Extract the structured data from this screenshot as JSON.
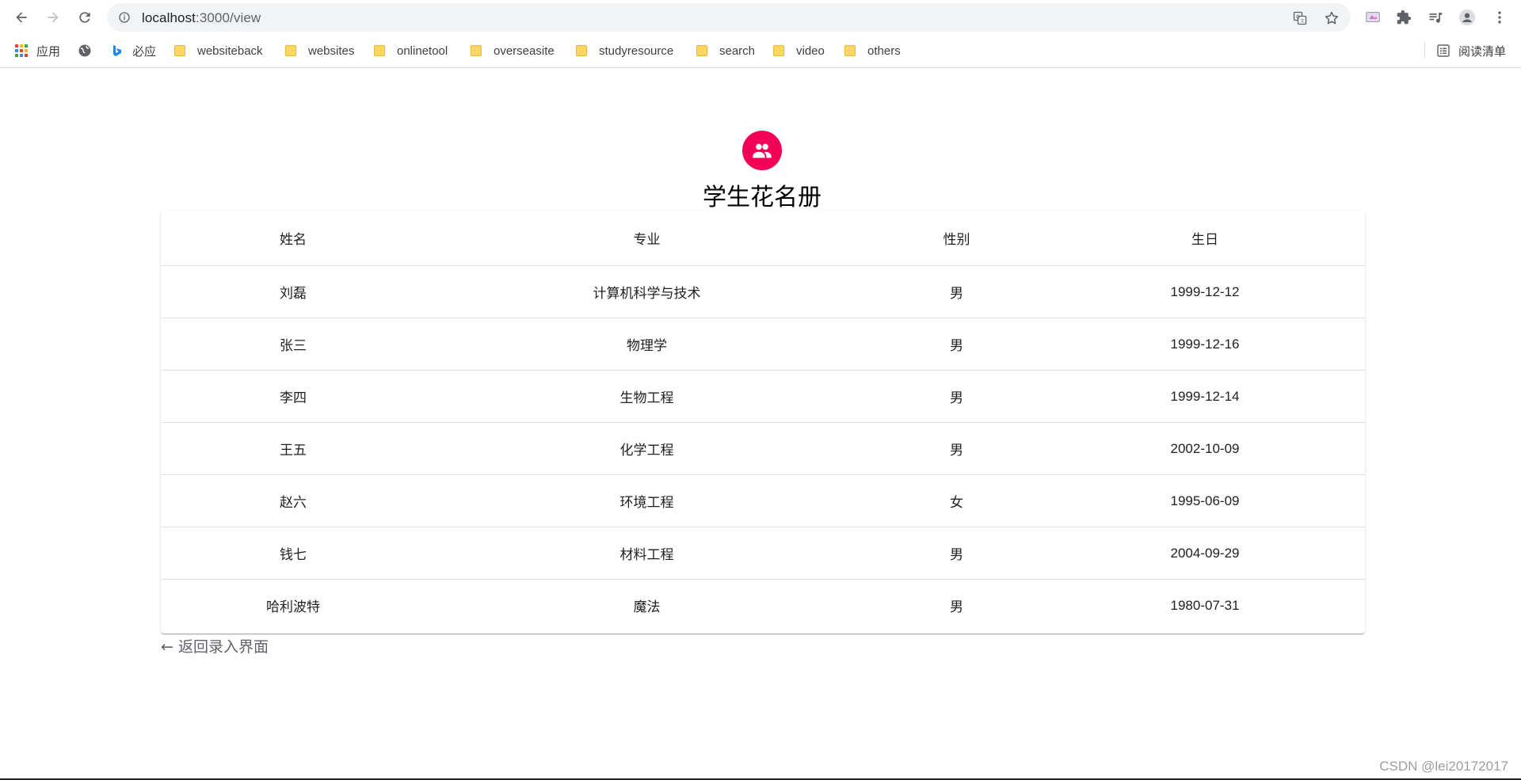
{
  "browser": {
    "url_host": "localhost",
    "url_path": ":3000/view",
    "bookmarks": [
      {
        "label": "应用",
        "icon": "apps-grid-icon"
      },
      {
        "label": "",
        "icon": "globe-icon"
      },
      {
        "label": "必应",
        "icon": "bing-icon"
      },
      {
        "label": "websiteback",
        "icon": "folder-icon"
      },
      {
        "label": "websites",
        "icon": "folder-icon"
      },
      {
        "label": "onlinetool",
        "icon": "folder-icon"
      },
      {
        "label": "overseasite",
        "icon": "folder-icon"
      },
      {
        "label": "studyresource",
        "icon": "folder-icon"
      },
      {
        "label": "search",
        "icon": "folder-icon"
      },
      {
        "label": "video",
        "icon": "folder-icon"
      },
      {
        "label": "others",
        "icon": "folder-icon"
      }
    ],
    "reading_list_label": "阅读清单"
  },
  "page": {
    "title": "学生花名册",
    "avatar_icon": "people-icon",
    "accent_color": "#f50057",
    "back_link": "← 返回录入界面",
    "watermark": "CSDN @lei20172017"
  },
  "table": {
    "headers": [
      "姓名",
      "专业",
      "性别",
      "生日"
    ],
    "rows": [
      {
        "name": "刘磊",
        "major": "计算机科学与技术",
        "gender": "男",
        "birthday": "1999-12-12"
      },
      {
        "name": "张三",
        "major": "物理学",
        "gender": "男",
        "birthday": "1999-12-16"
      },
      {
        "name": "李四",
        "major": "生物工程",
        "gender": "男",
        "birthday": "1999-12-14"
      },
      {
        "name": "王五",
        "major": "化学工程",
        "gender": "男",
        "birthday": "2002-10-09"
      },
      {
        "name": "赵六",
        "major": "环境工程",
        "gender": "女",
        "birthday": "1995-06-09"
      },
      {
        "name": "钱七",
        "major": "材料工程",
        "gender": "男",
        "birthday": "2004-09-29"
      },
      {
        "name": "哈利波特",
        "major": "魔法",
        "gender": "男",
        "birthday": "1980-07-31"
      }
    ]
  }
}
